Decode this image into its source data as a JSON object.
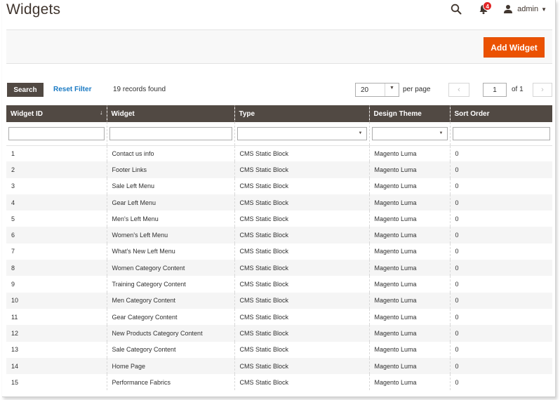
{
  "header": {
    "title": "Widgets",
    "notification_count": "4",
    "user_name": "admin",
    "icons": [
      "search-icon",
      "bell-icon",
      "user-icon",
      "caret-down-icon"
    ]
  },
  "action_bar": {
    "add_widget_label": "Add Widget"
  },
  "toolbar": {
    "search_label": "Search",
    "reset_filter_label": "Reset Filter",
    "records_found": "19 records found",
    "page_size": "20",
    "per_page_label": "per page",
    "current_page": "1",
    "page_total": "of 1"
  },
  "table": {
    "columns": [
      "Widget ID",
      "Widget",
      "Type",
      "Design Theme",
      "Sort Order"
    ],
    "rows": [
      [
        "1",
        "Contact us info",
        "CMS Static Block",
        "Magento Luma",
        "0"
      ],
      [
        "2",
        "Footer Links",
        "CMS Static Block",
        "Magento Luma",
        "0"
      ],
      [
        "3",
        "Sale Left Menu",
        "CMS Static Block",
        "Magento Luma",
        "0"
      ],
      [
        "4",
        "Gear Left Menu",
        "CMS Static Block",
        "Magento Luma",
        "0"
      ],
      [
        "5",
        "Men's Left Menu",
        "CMS Static Block",
        "Magento Luma",
        "0"
      ],
      [
        "6",
        "Women's Left Menu",
        "CMS Static Block",
        "Magento Luma",
        "0"
      ],
      [
        "7",
        "What's New Left Menu",
        "CMS Static Block",
        "Magento Luma",
        "0"
      ],
      [
        "8",
        "Women Category Content",
        "CMS Static Block",
        "Magento Luma",
        "0"
      ],
      [
        "9",
        "Training Category Content",
        "CMS Static Block",
        "Magento Luma",
        "0"
      ],
      [
        "10",
        "Men Category Content",
        "CMS Static Block",
        "Magento Luma",
        "0"
      ],
      [
        "11",
        "Gear Category Content",
        "CMS Static Block",
        "Magento Luma",
        "0"
      ],
      [
        "12",
        "New Products Category Content",
        "CMS Static Block",
        "Magento Luma",
        "0"
      ],
      [
        "13",
        "Sale Category Content",
        "CMS Static Block",
        "Magento Luma",
        "0"
      ],
      [
        "14",
        "Home Page",
        "CMS Static Block",
        "Magento Luma",
        "0"
      ],
      [
        "15",
        "Performance Fabrics",
        "CMS Static Block",
        "Magento Luma",
        "0"
      ]
    ]
  },
  "colors": {
    "accent": "#eb5202",
    "header_bg": "#514943",
    "link": "#1979c3",
    "badge": "#e22626"
  }
}
